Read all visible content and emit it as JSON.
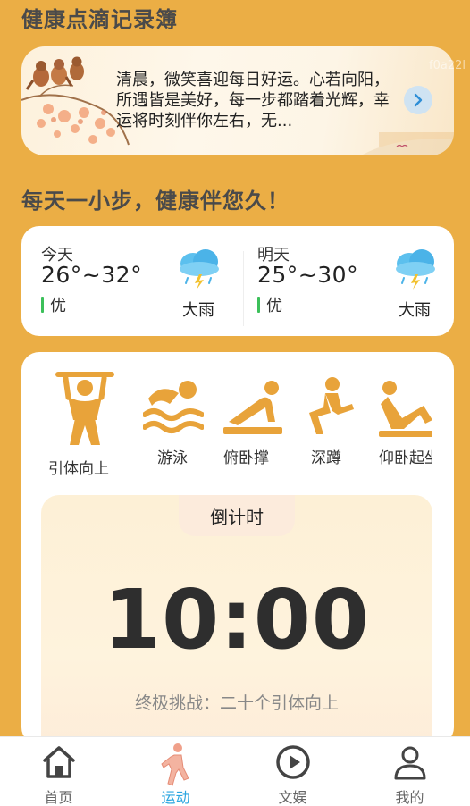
{
  "header": {
    "title": "健康点滴记录簿"
  },
  "overflow_id": "f0a22l",
  "banner": {
    "text": "清晨，微笑喜迎每日好运。心若向阳，所遇皆是美好，每一步都踏着光辉，幸运将时刻伴你左右，无...",
    "arrow_icon": "chevron-right-icon"
  },
  "slogan": "每天一小步，健康伴您久！",
  "weather": {
    "today": {
      "day": "今天",
      "temp": "26°~32°",
      "aqi": "优",
      "condition": "大雨",
      "icon": "heavy-rain-icon"
    },
    "tomorrow": {
      "day": "明天",
      "temp": "25°~30°",
      "aqi": "优",
      "condition": "大雨",
      "icon": "heavy-rain-icon"
    }
  },
  "exercises": [
    {
      "label": "引体向上",
      "icon": "pull-up-icon"
    },
    {
      "label": "游泳",
      "icon": "swimming-icon"
    },
    {
      "label": "俯卧撑",
      "icon": "push-up-icon"
    },
    {
      "label": "深蹲",
      "icon": "squat-icon"
    },
    {
      "label": "仰卧起坐",
      "icon": "sit-up-icon"
    }
  ],
  "timer": {
    "tab_label": "倒计时",
    "time": "10:00",
    "description": "终极挑战：二十个引体向上"
  },
  "tabbar": {
    "items": [
      {
        "label": "首页",
        "icon": "home-icon",
        "active": false
      },
      {
        "label": "运动",
        "icon": "walking-icon",
        "active": true
      },
      {
        "label": "文娱",
        "icon": "play-icon",
        "active": false
      },
      {
        "label": "我的",
        "icon": "user-icon",
        "active": false
      }
    ]
  },
  "colors": {
    "background": "#EBAE45",
    "accent_icon": "#E8A33A",
    "active_tab": "#2AA6E0",
    "aqi_good": "#3CC05A"
  }
}
